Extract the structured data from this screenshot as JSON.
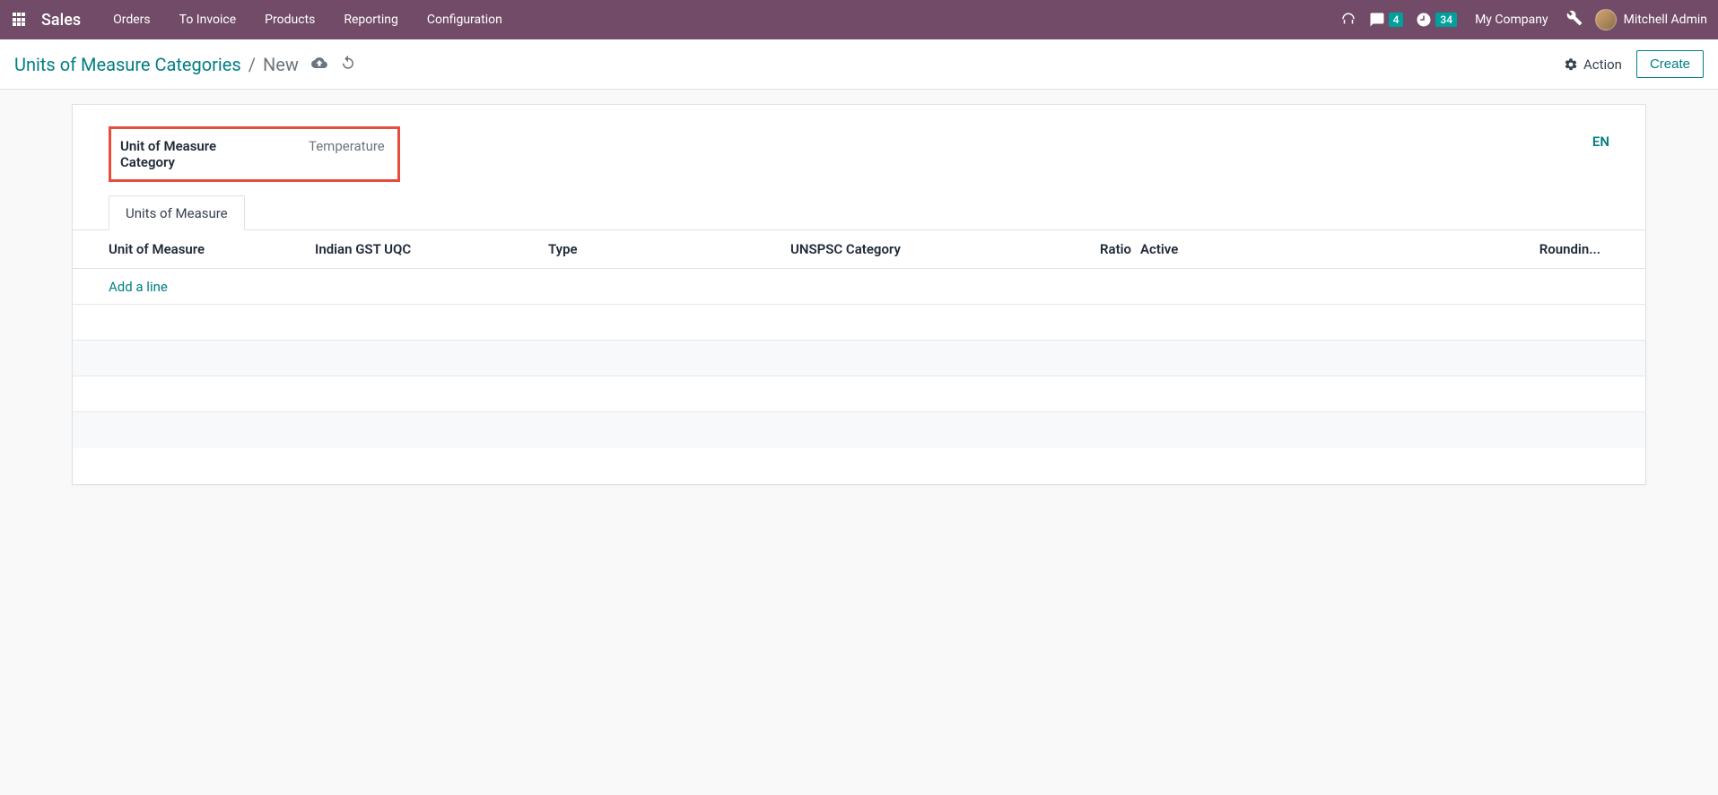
{
  "header": {
    "brand": "Sales",
    "nav": [
      "Orders",
      "To Invoice",
      "Products",
      "Reporting",
      "Configuration"
    ],
    "messages_count": "4",
    "activities_count": "34",
    "company": "My Company",
    "user": "Mitchell Admin"
  },
  "breadcrumb": {
    "parent": "Units of Measure Categories",
    "current": "New"
  },
  "actions": {
    "action_label": "Action",
    "create_label": "Create"
  },
  "form": {
    "field_label": "Unit of Measure Category",
    "field_value": "Temperature",
    "lang": "EN"
  },
  "tabs": {
    "tab1": "Units of Measure"
  },
  "table": {
    "columns": {
      "uom": "Unit of Measure",
      "gst": "Indian GST UQC",
      "type": "Type",
      "unspsc": "UNSPSC Category",
      "ratio": "Ratio",
      "active": "Active",
      "rounding": "Roundin..."
    },
    "add_line": "Add a line"
  }
}
